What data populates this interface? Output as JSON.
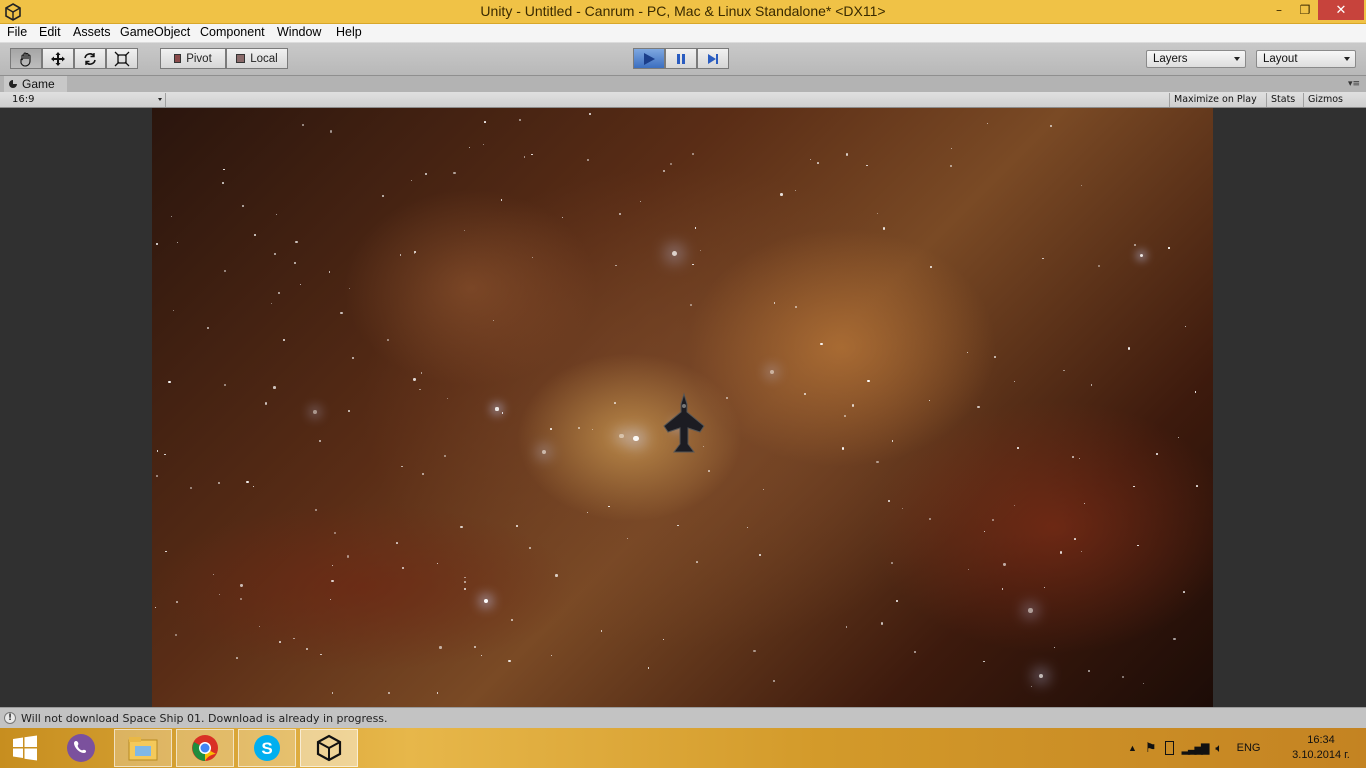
{
  "window": {
    "title": "Unity - Untitled - Canrum - PC, Mac & Linux Standalone* <DX11>",
    "min": "–",
    "max": "❐",
    "close": "✕"
  },
  "menu": [
    "File",
    "Edit",
    "Assets",
    "GameObject",
    "Component",
    "Window",
    "Help"
  ],
  "toolbar": {
    "pivot": "Pivot",
    "local": "Local",
    "layers": "Layers",
    "layout": "Layout"
  },
  "game_tab": {
    "label": "Game",
    "aspect": "16:9",
    "maximize": "Maximize on Play",
    "stats": "Stats",
    "gizmos": "Gizmos"
  },
  "status": {
    "message": "Will not download Space Ship 01. Download is already in progress."
  },
  "taskbar": {
    "apps": [
      "viber-icon",
      "file-explorer-icon",
      "chrome-icon",
      "skype-icon",
      "unity-icon"
    ],
    "language": "ENG",
    "time": "16:34",
    "date": "3.10.2014 г."
  },
  "colors": {
    "title_bar": "#f0c246",
    "close_button": "#c7433c",
    "play_active": "#3c6fc0",
    "taskbar": "#d39a2a"
  }
}
